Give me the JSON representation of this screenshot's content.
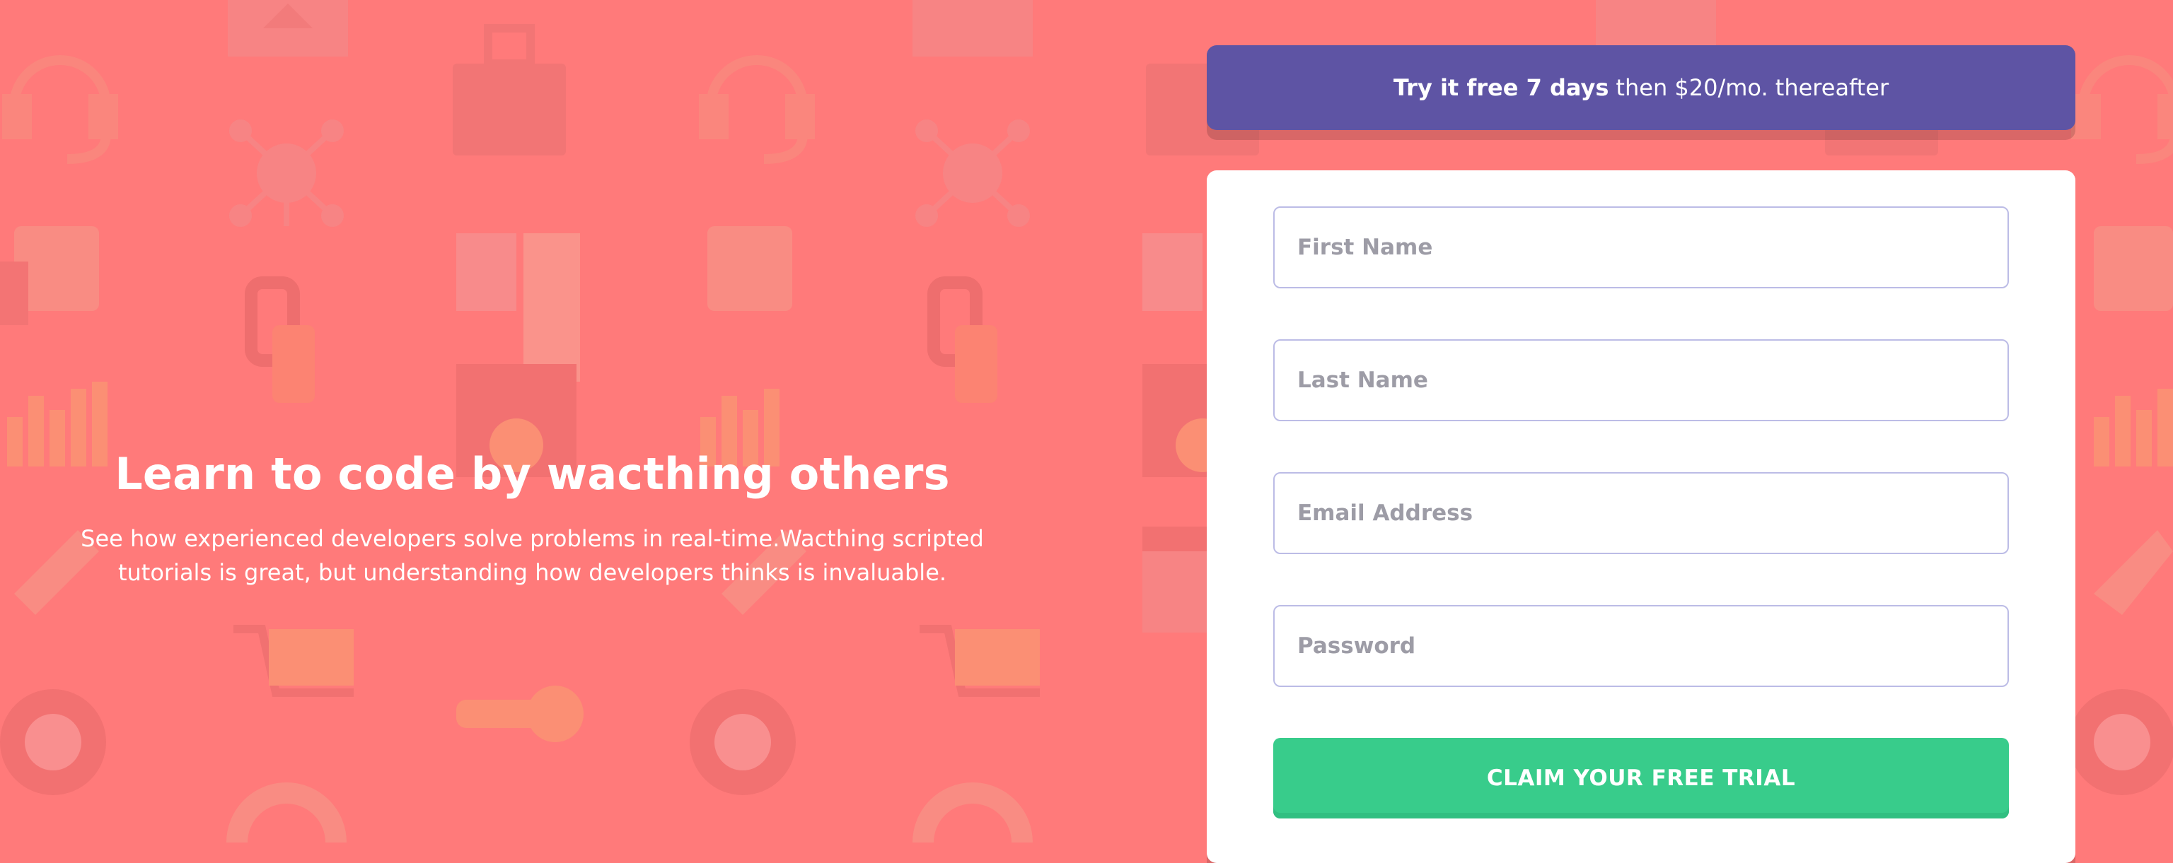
{
  "hero": {
    "title": "Learn to code by wacthing others",
    "description": "See how experienced developers solve problems in real-time.Wacthing scripted tutorials is great, but understanding how developers thinks is invaluable."
  },
  "offer": {
    "highlight": "Try it free 7 days",
    "rest": "then $20/mo. thereafter"
  },
  "form": {
    "first_name_placeholder": "First Name",
    "last_name_placeholder": "Last Name",
    "email_placeholder": "Email Address",
    "password_placeholder": "Password",
    "submit_label": "CLAIM YOUR FREE TRIAL"
  },
  "colors": {
    "background": "#ff7a7a",
    "banner": "#5e54a4",
    "button": "#38cc8b",
    "field_border": "#bcbce6",
    "placeholder": "#9d9ca6"
  }
}
